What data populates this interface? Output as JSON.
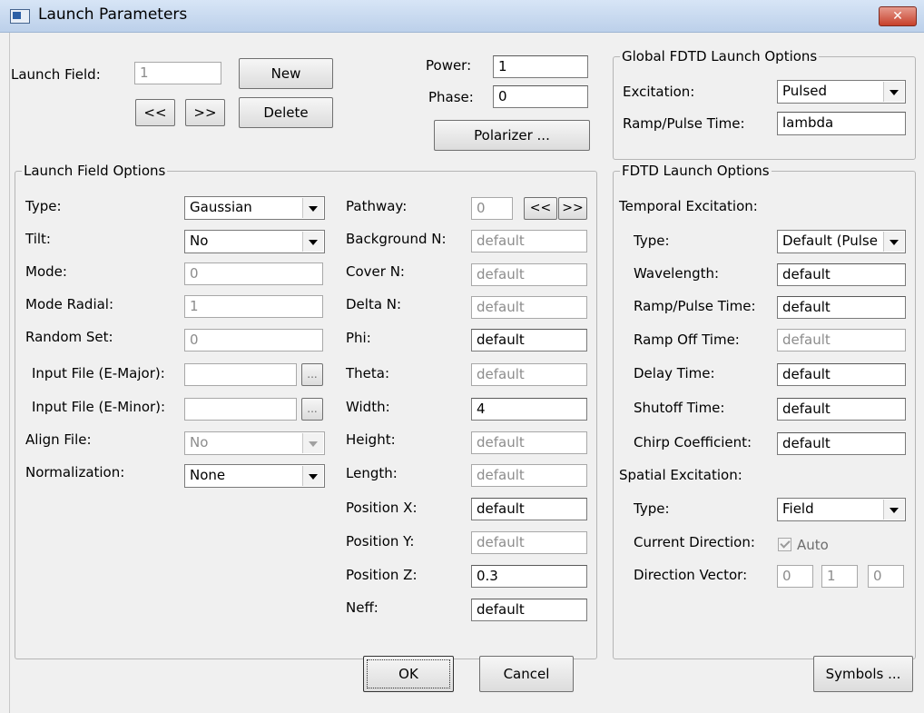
{
  "window": {
    "title": "Launch Parameters",
    "close_glyph": "✕"
  },
  "top": {
    "launch_field_label": "Launch Field:",
    "launch_field_value": "1",
    "new_label": "New",
    "prev_label": "<<",
    "next_label": ">>",
    "delete_label": "Delete",
    "power_label": "Power:",
    "power_value": "1",
    "phase_label": "Phase:",
    "phase_value": "0",
    "polarizer_label": "Polarizer ..."
  },
  "global_fdtd": {
    "legend": "Global FDTD Launch Options",
    "excitation_label": "Excitation:",
    "excitation_value": "Pulsed",
    "ramp_label": "Ramp/Pulse Time:",
    "ramp_value": "lambda"
  },
  "launch_field_options": {
    "legend": "Launch Field Options",
    "type_label": "Type:",
    "type_value": "Gaussian",
    "tilt_label": "Tilt:",
    "tilt_value": "No",
    "mode_label": "Mode:",
    "mode_value": "0",
    "mode_radial_label": "Mode Radial:",
    "mode_radial_value": "1",
    "random_set_label": "Random Set:",
    "random_set_value": "0",
    "input_major_label": "Input File (E-Major):",
    "input_major_value": "",
    "input_minor_label": "Input File (E-Minor):",
    "input_minor_value": "",
    "browse_label": "...",
    "align_label": "Align File:",
    "align_value": "No",
    "normalization_label": "Normalization:",
    "normalization_value": "None",
    "pathway_label": "Pathway:",
    "pathway_value": "0",
    "pathway_prev": "<<",
    "pathway_next": ">>",
    "background_label": "Background N:",
    "background_value": "default",
    "cover_label": "Cover N:",
    "cover_value": "default",
    "delta_label": "Delta N:",
    "delta_value": "default",
    "phi_label": "Phi:",
    "phi_value": "default",
    "theta_label": "Theta:",
    "theta_value": "default",
    "width_label": "Width:",
    "width_value": "4",
    "height_label": "Height:",
    "height_value": "default",
    "length_label": "Length:",
    "length_value": "default",
    "posx_label": "Position X:",
    "posx_value": "default",
    "posy_label": "Position Y:",
    "posy_value": "default",
    "posz_label": "Position Z:",
    "posz_value": "0.3",
    "neff_label": "Neff:",
    "neff_value": "default"
  },
  "fdtd_launch": {
    "legend": "FDTD Launch Options",
    "temporal_label": "Temporal Excitation:",
    "type_label": "Type:",
    "type_value": "Default (Pulse",
    "wavelength_label": "Wavelength:",
    "wavelength_value": "default",
    "ramp_label": "Ramp/Pulse Time:",
    "ramp_value": "default",
    "ramp_off_label": "Ramp Off Time:",
    "ramp_off_value": "default",
    "delay_label": "Delay Time:",
    "delay_value": "default",
    "shutoff_label": "Shutoff Time:",
    "shutoff_value": "default",
    "chirp_label": "Chirp Coefficient:",
    "chirp_value": "default",
    "spatial_label": "Spatial Excitation:",
    "stype_label": "Type:",
    "stype_value": "Field",
    "current_dir_label": "Current Direction:",
    "auto_label": "Auto",
    "direction_label": "Direction Vector:",
    "dir_x": "0",
    "dir_y": "1",
    "dir_z": "0"
  },
  "footer": {
    "ok_label": "OK",
    "cancel_label": "Cancel",
    "symbols_label": "Symbols ..."
  }
}
